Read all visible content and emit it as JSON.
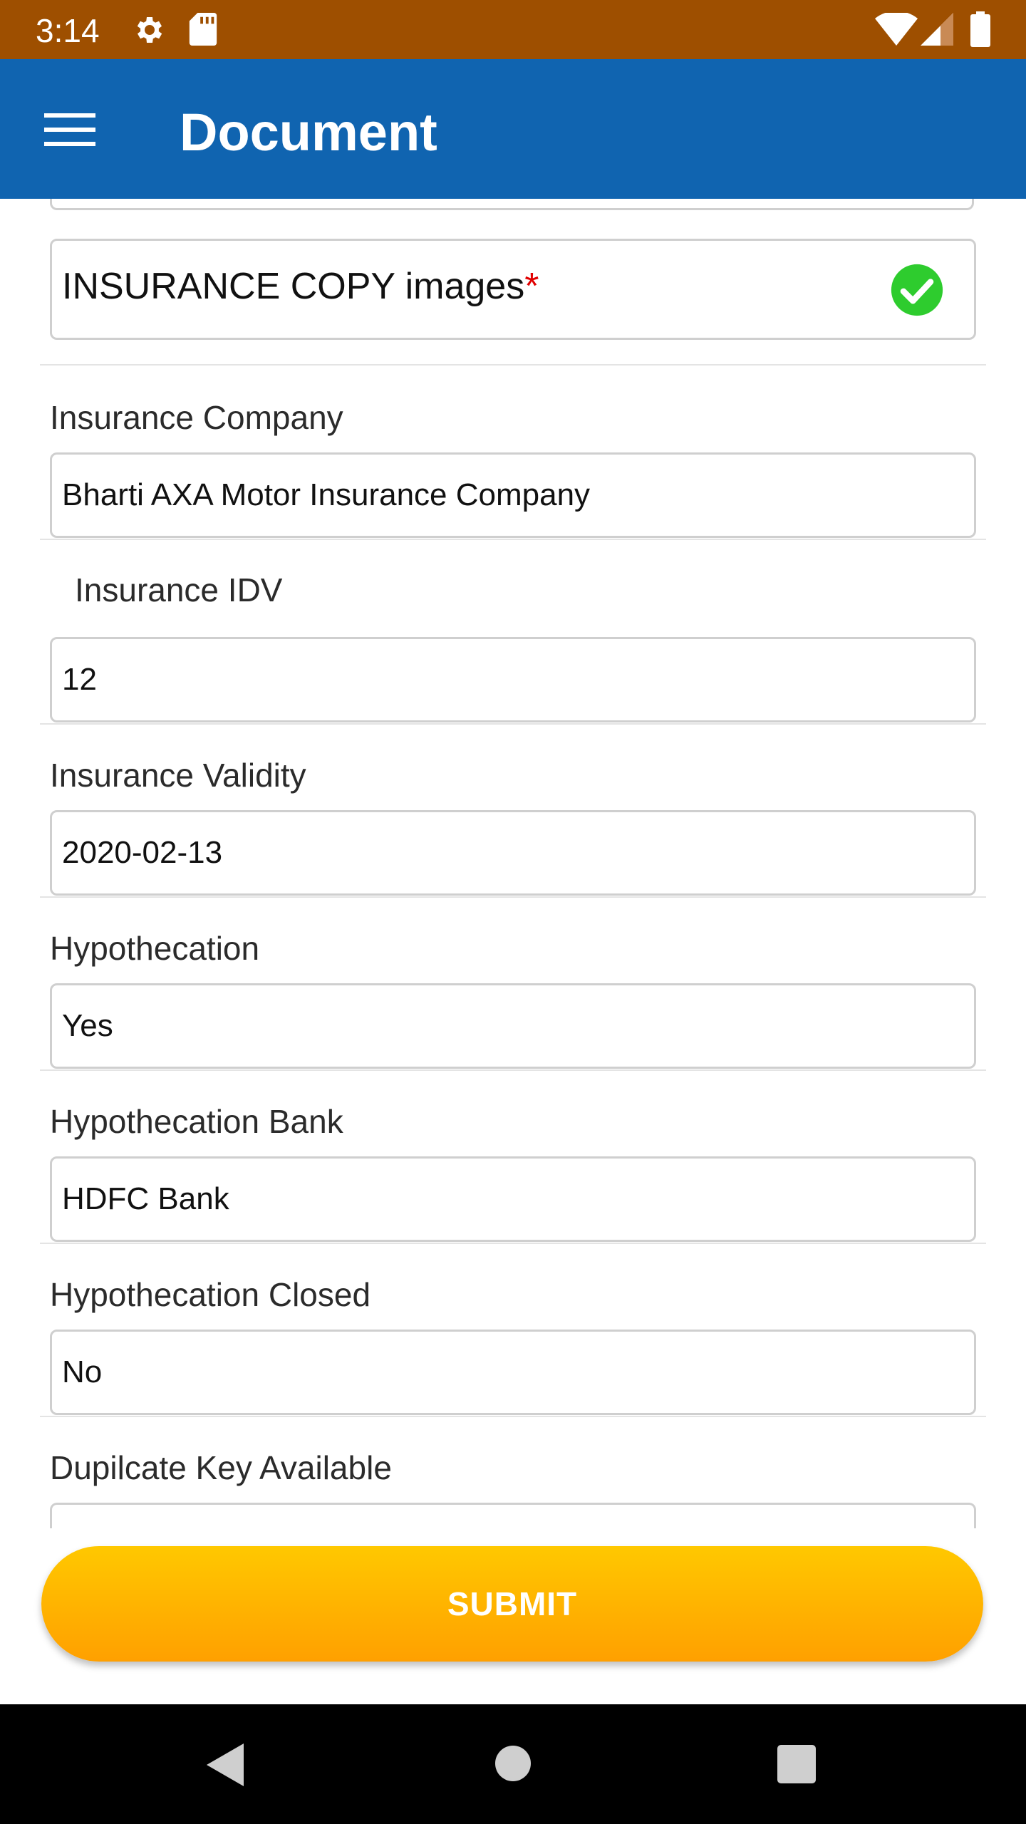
{
  "status_bar": {
    "time": "3:14",
    "icons": [
      "gear-icon",
      "sd-card-icon",
      "wifi-icon",
      "signal-icon",
      "battery-icon"
    ]
  },
  "app_bar": {
    "title": "Document",
    "menu_icon": "hamburger-menu-icon"
  },
  "upload": {
    "label": "INSURANCE COPY images",
    "required_mark": "*",
    "status_icon": "check-circle-icon"
  },
  "fields": [
    {
      "label": "Insurance Company",
      "value": "Bharti AXA Motor Insurance Company"
    },
    {
      "label": "Insurance IDV",
      "value": "12"
    },
    {
      "label": "Insurance Validity",
      "value": "2020-02-13"
    },
    {
      "label": "Hypothecation",
      "value": "Yes"
    },
    {
      "label": "Hypothecation Bank",
      "value": "HDFC Bank"
    },
    {
      "label": "Hypothecation Closed",
      "value": "No"
    },
    {
      "label": "Dupilcate Key Available",
      "value": ""
    }
  ],
  "submit_label": "SUBMIT",
  "colors": {
    "status_bar": "#9e4f00",
    "app_bar": "#1064b0",
    "submit": "#ffb300",
    "check": "#2ecc2e",
    "required": "#e00000"
  }
}
